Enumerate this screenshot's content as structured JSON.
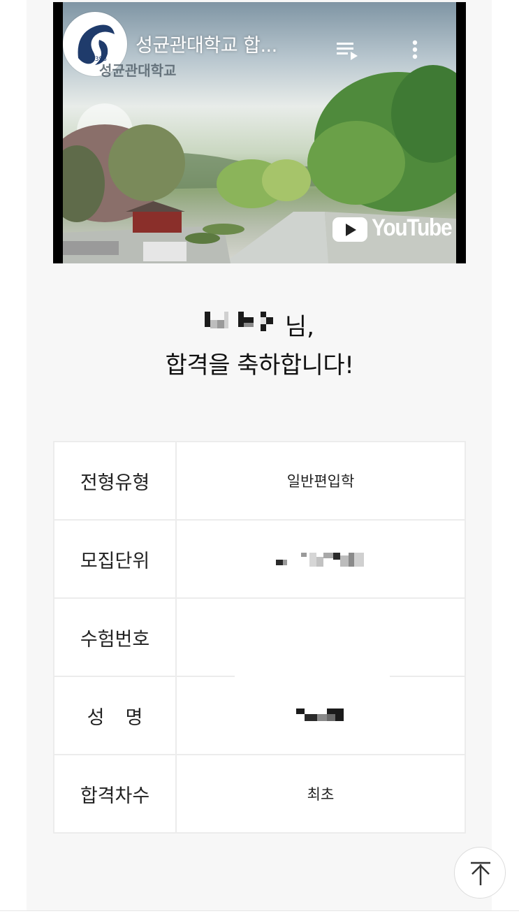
{
  "video": {
    "title": "성균관대학교 합...",
    "subtitle": "성균관대학교",
    "logo_year": "1398",
    "brand": "YouTube",
    "icons": [
      "playlist-icon",
      "more-vert-icon",
      "youtube-play-icon"
    ]
  },
  "greeting": {
    "name_suffix": "님,",
    "message": "합격을 축하합니다!"
  },
  "result": {
    "rows": [
      {
        "label": "전형유형",
        "value": "일반편입학"
      },
      {
        "label": "모집단위",
        "value": ""
      },
      {
        "label": "수험번호",
        "value": ""
      },
      {
        "label": "성명",
        "value": ""
      },
      {
        "label": "합격차수",
        "value": "최초"
      }
    ]
  },
  "colors": {
    "panel_bg": "#f7f7f7",
    "table_border": "#ececec",
    "text": "#111111"
  },
  "scroll_top": {
    "icon": "arrow-up-to-top-icon"
  }
}
